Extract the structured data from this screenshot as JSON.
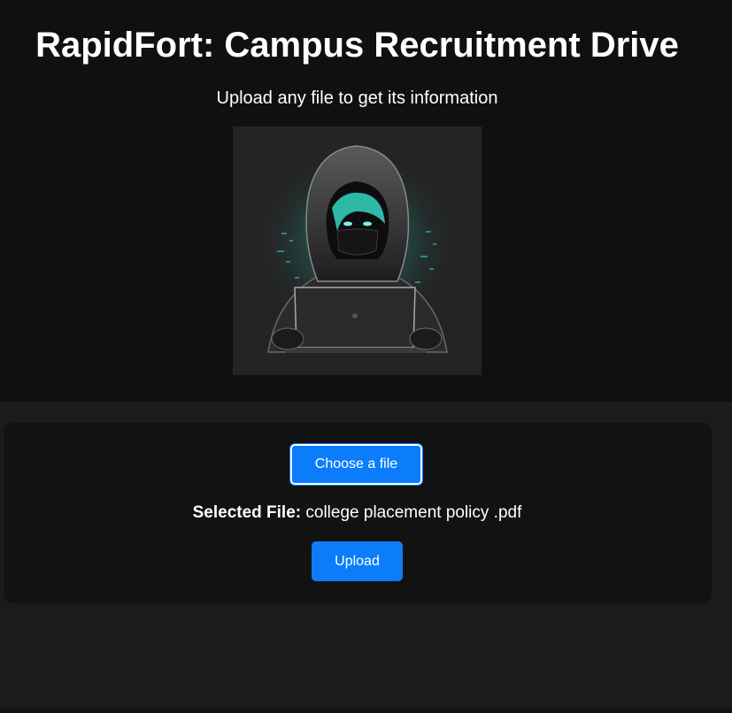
{
  "header": {
    "title": "RapidFort: Campus Recruitment Drive",
    "subtitle": "Upload any file to get its information"
  },
  "hero_image": {
    "icon": "hooded-hacker-laptop-illustration"
  },
  "upload_card": {
    "choose_label": "Choose a file",
    "selected_prefix": "Selected File:",
    "selected_filename": "college placement policy .pdf",
    "upload_label": "Upload"
  },
  "colors": {
    "accent": "#0b7dfb",
    "header_bg": "#101010",
    "page_bg": "#1b1b1b",
    "card_bg": "#121212",
    "glow": "#2fd3c0"
  }
}
